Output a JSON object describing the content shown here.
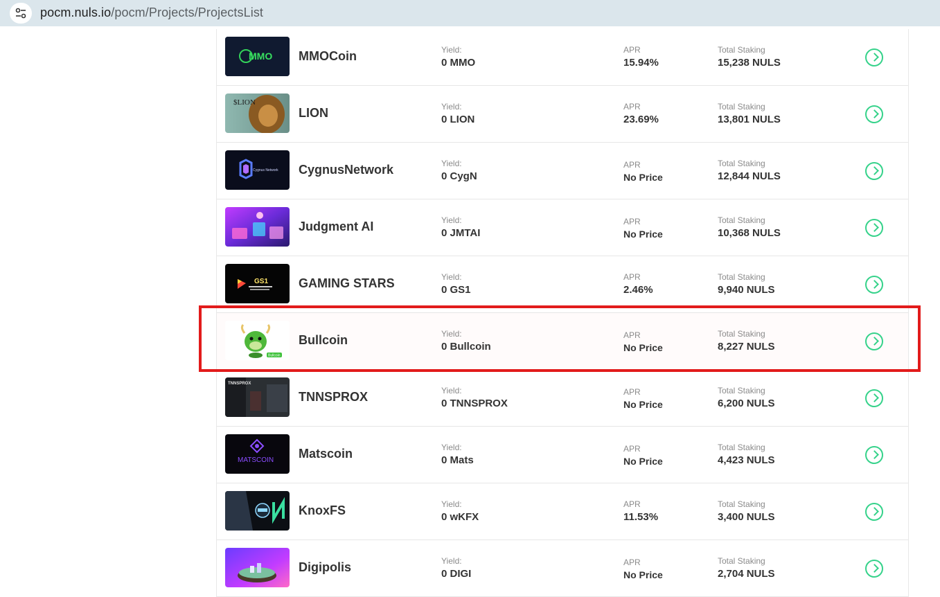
{
  "browser": {
    "url_host": "pocm.nuls.io",
    "url_path": "/pocm/Projects/ProjectsList"
  },
  "labels": {
    "yield": "Yield:",
    "apr": "APR",
    "total_staking": "Total Staking"
  },
  "colors": {
    "accent": "#35d28a",
    "highlight_border": "#e21b1b"
  },
  "projects": [
    {
      "name": "MMOCoin",
      "yield": "0 MMO",
      "apr": "15.94%",
      "total": "15,238 NULS",
      "logo_text": "MMO"
    },
    {
      "name": "LION",
      "yield": "0 LION",
      "apr": "23.69%",
      "total": "13,801 NULS",
      "logo_text": "$LION"
    },
    {
      "name": "CygnusNetwork",
      "yield": "0 CygN",
      "apr": "No Price",
      "total": "12,844 NULS",
      "logo_text": "Cygnus Network"
    },
    {
      "name": "Judgment AI",
      "yield": "0 JMTAI",
      "apr": "No Price",
      "total": "10,368 NULS",
      "logo_text": ""
    },
    {
      "name": "GAMING STARS",
      "yield": "0 GS1",
      "apr": "2.46%",
      "total": "9,940 NULS",
      "logo_text": "GS1"
    },
    {
      "name": "Bullcoin",
      "yield": "0 Bullcoin",
      "apr": "No Price",
      "total": "8,227 NULS",
      "logo_text": "Bullcoin"
    },
    {
      "name": "TNNSPROX",
      "yield": "0 TNNSPROX",
      "apr": "No Price",
      "total": "6,200 NULS",
      "logo_text": "TNNSPROX"
    },
    {
      "name": "Matscoin",
      "yield": "0 Mats",
      "apr": "No Price",
      "total": "4,423 NULS",
      "logo_text": "MATSCOIN"
    },
    {
      "name": "KnoxFS",
      "yield": "0 wKFX",
      "apr": "11.53%",
      "total": "3,400 NULS",
      "logo_text": ""
    },
    {
      "name": "Digipolis",
      "yield": "0 DIGI",
      "apr": "No Price",
      "total": "2,704 NULS",
      "logo_text": ""
    }
  ]
}
